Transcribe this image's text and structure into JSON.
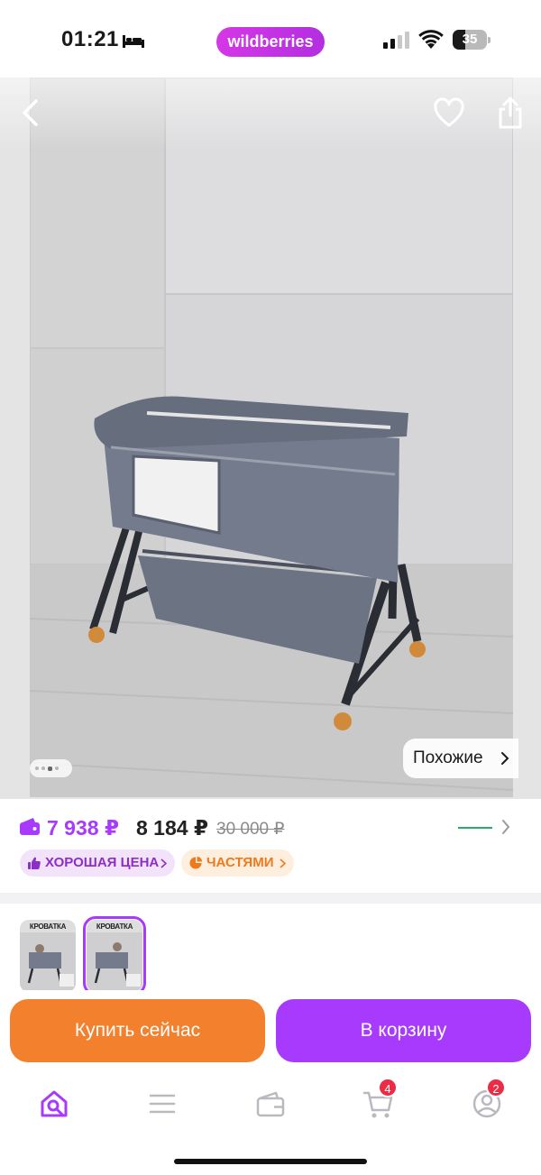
{
  "status_bar": {
    "time": "01:21",
    "brand": "wildberries",
    "battery": "35",
    "icons": [
      "bed-icon",
      "signal-icon",
      "wifi-icon",
      "battery-icon"
    ]
  },
  "gallery": {
    "icons": [
      "back-icon",
      "heart-icon",
      "share-icon"
    ],
    "similar_label": "Похожие",
    "page_count": 4,
    "active_page": 2
  },
  "price": {
    "wallet_price": "7 938 ₽",
    "regular_price": "8 184 ₽",
    "old_price": "30 000 ₽"
  },
  "badges": [
    {
      "label": "ХОРОШАЯ ЦЕНА",
      "icon": "thumbs-up-icon"
    },
    {
      "label": "ЧАСТЯМИ",
      "icon": "pie-chart-icon"
    }
  ],
  "thumbnails": [
    {
      "title": "КРОВАТКА",
      "selected": false
    },
    {
      "title": "КРОВАТКА",
      "selected": true
    }
  ],
  "actions": {
    "buy_now": "Купить сейчас",
    "add_to_cart": "В корзину"
  },
  "tabbar": {
    "items": [
      {
        "name": "home-search",
        "icon": "search-home-icon",
        "active": true
      },
      {
        "name": "catalog",
        "icon": "menu-icon"
      },
      {
        "name": "wallet",
        "icon": "wallet-icon"
      },
      {
        "name": "cart",
        "icon": "cart-icon",
        "badge": "4"
      },
      {
        "name": "profile",
        "icon": "profile-icon",
        "badge": "2"
      }
    ]
  },
  "colors": {
    "accent": "#a73afd",
    "buy_now": "#f2802c",
    "badge_red": "#ee2b45",
    "price_positive": "#27ae60"
  }
}
